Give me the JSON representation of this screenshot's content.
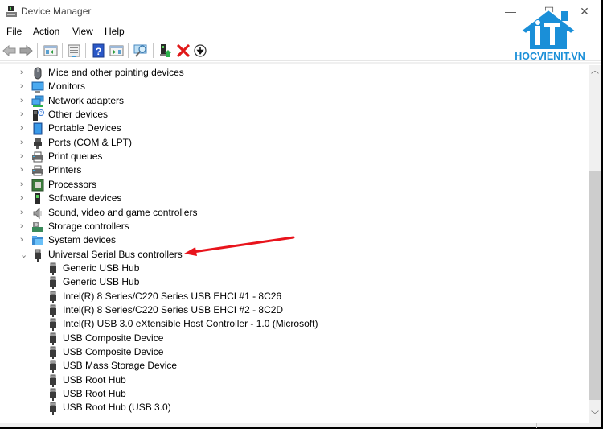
{
  "window": {
    "title": "Device Manager",
    "controls": {
      "minimize": "—",
      "maximize": "☐",
      "close": "✕"
    }
  },
  "menu": [
    "File",
    "Action",
    "View",
    "Help"
  ],
  "toolbar": [
    {
      "icon": "back-arrow-icon",
      "tooltip": "Back"
    },
    {
      "icon": "forward-arrow-icon",
      "tooltip": "Forward"
    },
    {
      "icon": "show-hide-console-tree-icon",
      "tooltip": "Show/Hide Console Tree"
    },
    {
      "icon": "properties-icon",
      "tooltip": "Properties"
    },
    {
      "icon": "help-icon",
      "tooltip": "Help"
    },
    {
      "icon": "show-hide-action-pane-icon",
      "tooltip": "Show/Hide Action Pane"
    },
    {
      "icon": "scan-hardware-icon",
      "tooltip": "Scan for hardware changes"
    },
    {
      "icon": "update-driver-icon",
      "tooltip": "Update Driver"
    },
    {
      "icon": "uninstall-device-icon",
      "tooltip": "Uninstall Device"
    },
    {
      "icon": "disable-device-icon",
      "tooltip": "Disable Device"
    }
  ],
  "logo": {
    "text": "HOCVIENIT.VN",
    "brand_color": "#1a8fd8"
  },
  "tree": {
    "categories": [
      {
        "label": "Mice and other pointing devices",
        "icon": "mouse-icon",
        "expanded": false
      },
      {
        "label": "Monitors",
        "icon": "monitor-icon",
        "expanded": false
      },
      {
        "label": "Network adapters",
        "icon": "network-adapter-icon",
        "expanded": false
      },
      {
        "label": "Other devices",
        "icon": "unknown-device-icon",
        "expanded": false
      },
      {
        "label": "Portable Devices",
        "icon": "portable-device-icon",
        "expanded": false
      },
      {
        "label": "Ports (COM & LPT)",
        "icon": "port-icon",
        "expanded": false
      },
      {
        "label": "Print queues",
        "icon": "printer-icon",
        "expanded": false
      },
      {
        "label": "Printers",
        "icon": "printer-icon",
        "expanded": false
      },
      {
        "label": "Processors",
        "icon": "processor-icon",
        "expanded": false
      },
      {
        "label": "Software devices",
        "icon": "software-device-icon",
        "expanded": false
      },
      {
        "label": "Sound, video and game controllers",
        "icon": "speaker-icon",
        "expanded": false
      },
      {
        "label": "Storage controllers",
        "icon": "storage-controller-icon",
        "expanded": false
      },
      {
        "label": "System devices",
        "icon": "system-folder-icon",
        "expanded": false
      },
      {
        "label": "Universal Serial Bus controllers",
        "icon": "usb-icon",
        "expanded": true
      }
    ],
    "usb_children": [
      "Generic USB Hub",
      "Generic USB Hub",
      "Intel(R) 8 Series/C220 Series USB EHCI #1 - 8C26",
      "Intel(R) 8 Series/C220 Series USB EHCI #2 - 8C2D",
      "Intel(R) USB 3.0 eXtensible Host Controller - 1.0 (Microsoft)",
      "USB Composite Device",
      "USB Composite Device",
      "USB Mass Storage Device",
      "USB Root Hub",
      "USB Root Hub",
      "USB Root Hub (USB 3.0)"
    ]
  },
  "annotation": {
    "type": "arrow",
    "color": "#e8141c",
    "points_to": "Universal Serial Bus controllers"
  },
  "scrollbar": {
    "position_fraction": 0.28,
    "visible_fraction": 0.69
  }
}
